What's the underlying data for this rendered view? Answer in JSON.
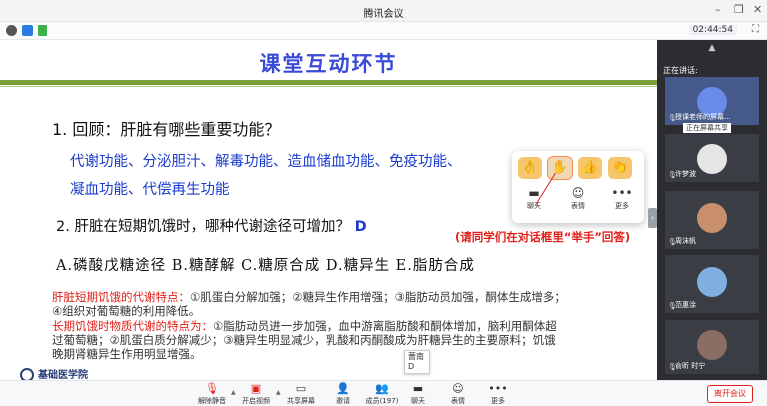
{
  "window": {
    "title": "腾讯会议",
    "time": "02:44:54"
  },
  "slide": {
    "title": "课堂互动环节",
    "q1": "1. 回顾：肝脏有哪些重要功能？",
    "ans1_line1": "代谢功能、分泌胆汁、解毒功能、造血储血功能、免疫功能、",
    "ans1_line2": "凝血功能、代偿再生功能",
    "q2_text": "2. 肝脏在短期饥饿时，哪种代谢途径可增加？",
    "q2_answer": "D",
    "options": "A.磷酸戊糖途径 B.糖酵解 C.糖原合成 D.糖异生 E.脂肪合成",
    "hint": "(请同学们在对话框里“举手”回答)",
    "note1_red": "肝脏短期饥饿的代谢特点：",
    "note1_a": "①肌蛋白分解加强；②糖异生作用增强；③脂肪动员加强，酮体生成增多；",
    "note1_b": "④组织对葡萄糖的利用降低。",
    "note2_red": "长期饥饿时物质代谢的特点为：",
    "note2_a": "①脂肪动员进一步加强，血中游离脂肪酸和酮体增加，脑利用酮体超",
    "note2_b": "过葡萄糖；②肌蛋白质分解减少；③糖异生明显减少，乳酸和丙酮酸成为肝糖异生的主要原料；饥饿",
    "note2_c": "晚期肾糖异生作用明显增强。",
    "footer": "基础医学院",
    "tooltip_name": "蔷南",
    "tooltip_val": "D"
  },
  "reaction_popup": {
    "emojis": [
      "👌",
      "✋",
      "👍",
      "👏"
    ],
    "actions": [
      {
        "icon": "chat-icon",
        "label": "聊天"
      },
      {
        "icon": "smile-icon",
        "label": "表情"
      },
      {
        "icon": "more-icon",
        "label": "更多"
      }
    ]
  },
  "sidebar": {
    "speaking_label": "正在讲话:",
    "sharing_badge": "正在屏幕共享",
    "participants": [
      {
        "name": "授课老师的屏幕...",
        "color": "#5a7bd8"
      },
      {
        "name": "许梦波",
        "color": "#dddddd"
      },
      {
        "name": "周沫帆",
        "color": "#c98f6a"
      },
      {
        "name": "范惠涂",
        "color": "#7fb0e0"
      },
      {
        "name": "俞昕 时宁",
        "color": "#8a6e64"
      }
    ]
  },
  "toolbar": {
    "unmute": "解除静音",
    "video": "开启视频",
    "share": "共享屏幕",
    "invite": "邀请",
    "members": "成员(197)",
    "chat": "聊天",
    "reactions": "表情",
    "more": "更多",
    "leave": "离开会议"
  },
  "colors": {
    "accent": "#3a4bd8",
    "answer": "#1a3bd0",
    "red": "#e0201a",
    "sidebar": "#2b2d31"
  }
}
